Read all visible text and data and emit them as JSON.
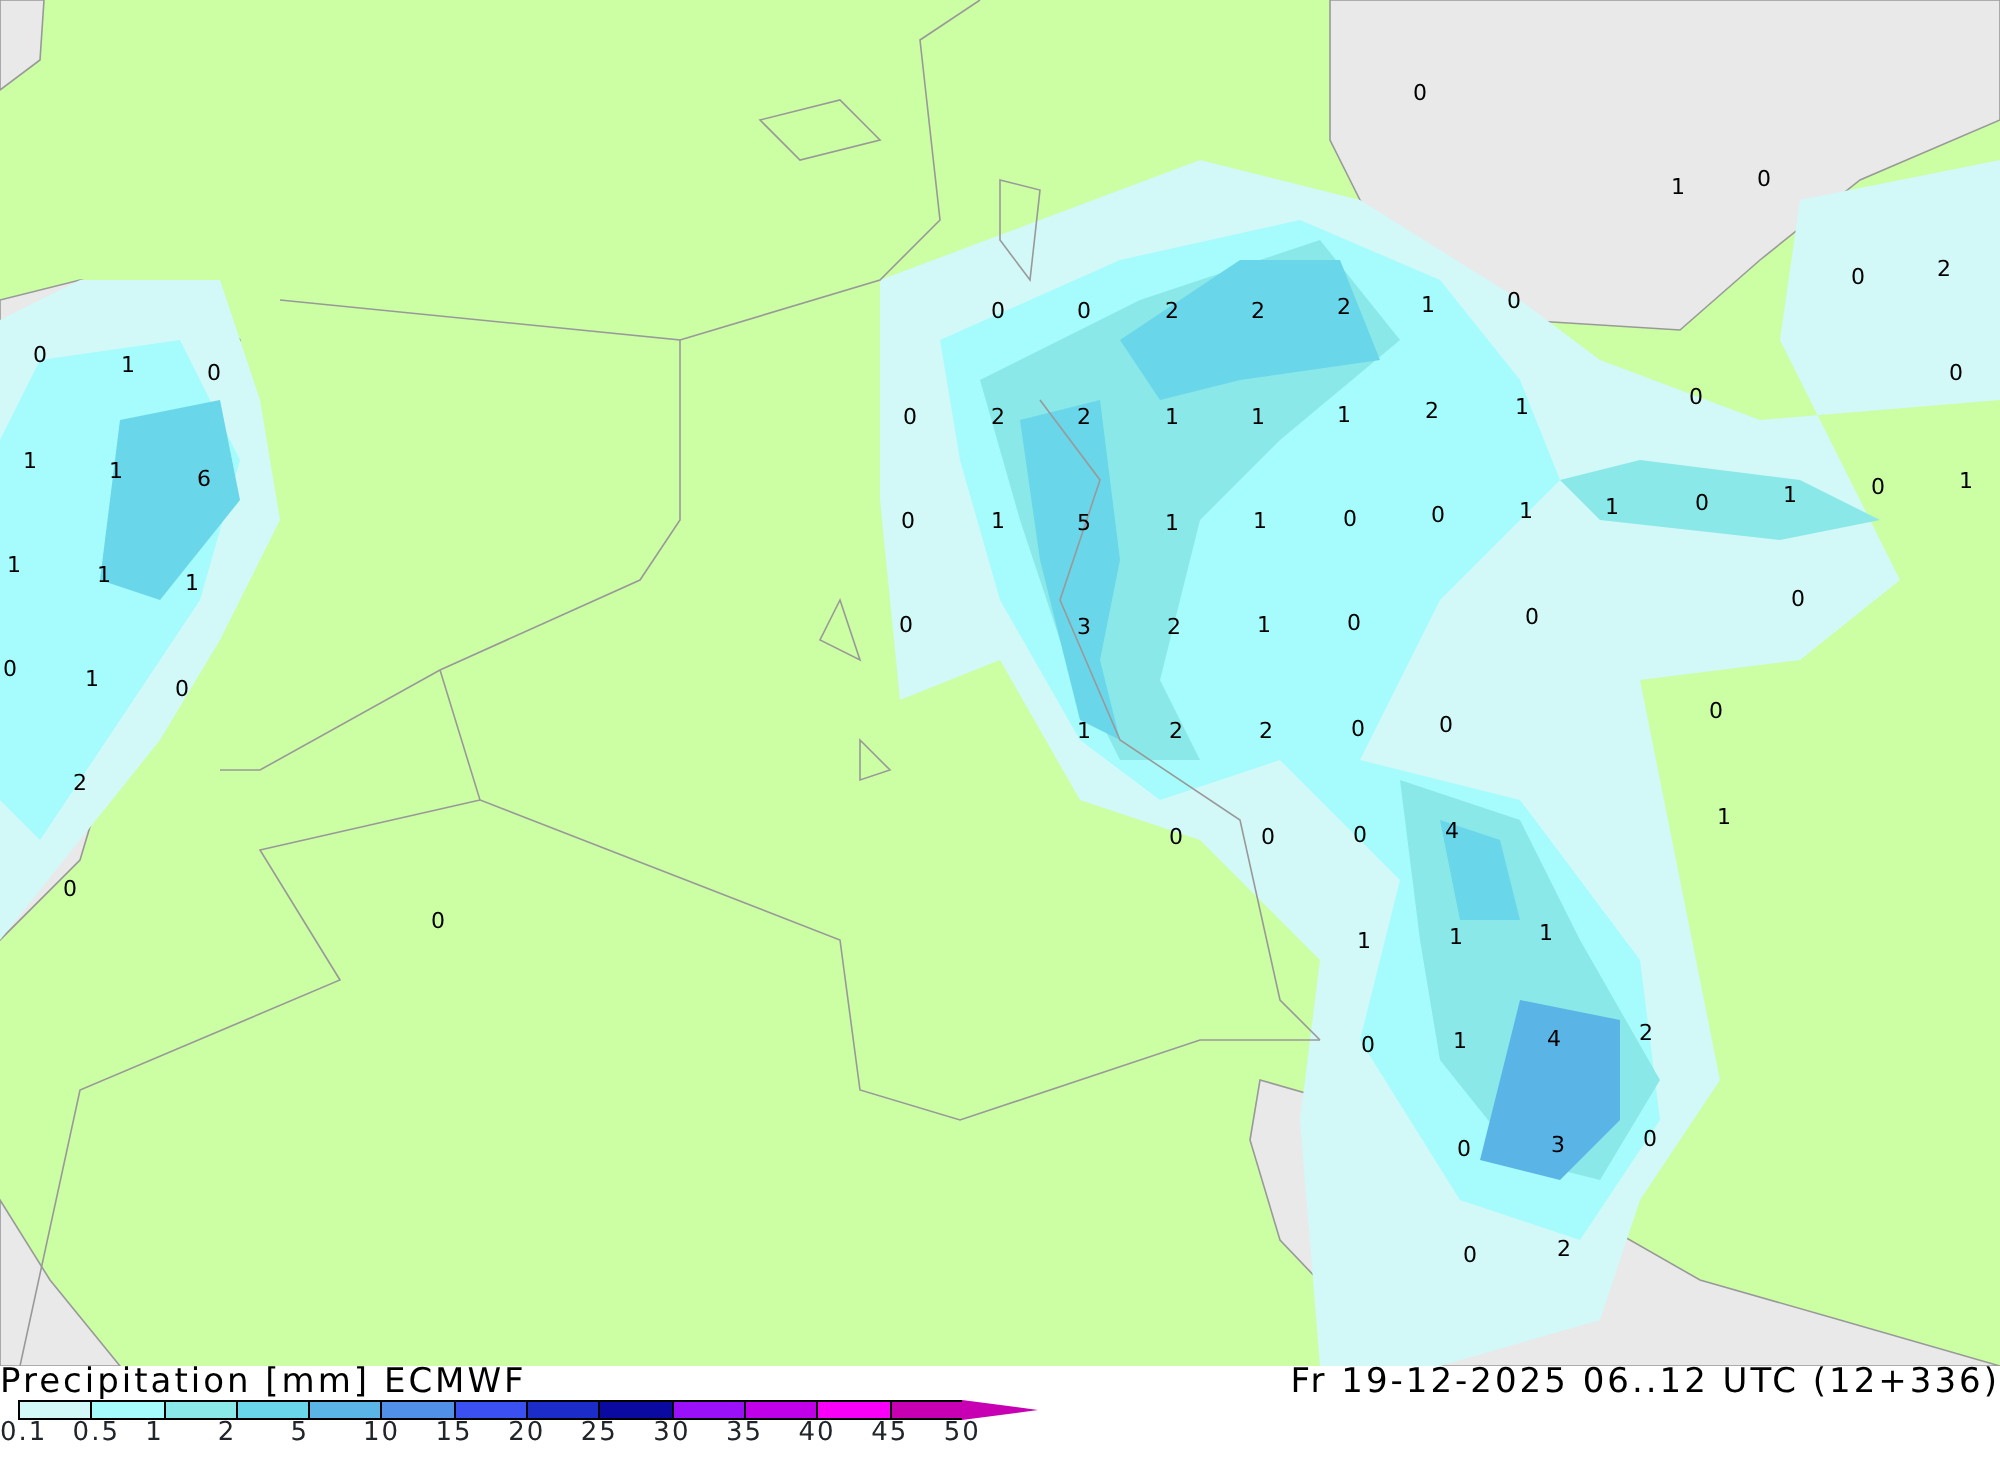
{
  "map": {
    "values": [
      "0",
      "1",
      "0",
      "1",
      "1",
      "6",
      "1",
      "1",
      "1",
      "0",
      "1",
      "0",
      "2",
      "0",
      "0",
      "0",
      "1",
      "0",
      "0",
      "2",
      "0",
      "0",
      "0",
      "0",
      "2",
      "2",
      "2",
      "1",
      "0",
      "0",
      "2",
      "2",
      "1",
      "1",
      "1",
      "2",
      "1",
      "0",
      "1",
      "5",
      "1",
      "1",
      "0",
      "0",
      "1",
      "1",
      "0",
      "1",
      "0",
      "1",
      "0",
      "3",
      "2",
      "1",
      "0",
      "0",
      "0",
      "1",
      "2",
      "2",
      "0",
      "0",
      "0",
      "0",
      "0",
      "0",
      "4",
      "1",
      "1",
      "1",
      "1",
      "0",
      "1",
      "4",
      "2",
      "0",
      "3",
      "0",
      "0",
      "2"
    ]
  },
  "title": "Precipitation [mm] ECMWF",
  "date": "Fr 19-12-2025 06..12 UTC (12+336)",
  "legend": {
    "bins": [
      {
        "color": "#d2f8f8"
      },
      {
        "color": "#a6fcfc"
      },
      {
        "color": "#8ae8e8"
      },
      {
        "color": "#6ad6ea"
      },
      {
        "color": "#5ab4e6"
      },
      {
        "color": "#5090e8"
      },
      {
        "color": "#3a50f0"
      },
      {
        "color": "#1c2cc8"
      },
      {
        "color": "#0a0aa0"
      },
      {
        "color": "#9a10f8"
      },
      {
        "color": "#c000e8"
      },
      {
        "color": "#f800f8"
      },
      {
        "color": "#c800b4"
      }
    ],
    "labels": [
      "0.1",
      "0.5",
      "1",
      "2",
      "5",
      "10",
      "15",
      "20",
      "25",
      "30",
      "35",
      "40",
      "45",
      "50"
    ]
  }
}
